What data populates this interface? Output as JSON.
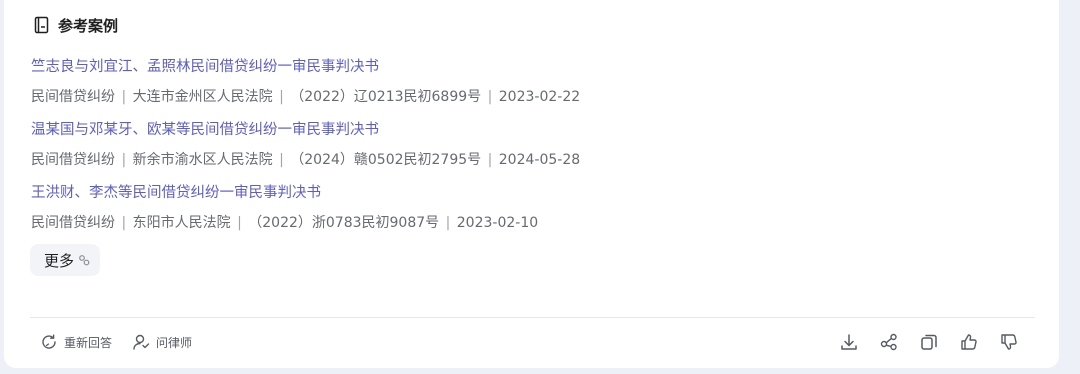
{
  "section": {
    "title": "参考案例",
    "icon": "document-icon"
  },
  "cases": [
    {
      "title": "竺志良与刘宜江、孟照林民间借贷纠纷一审民事判决书",
      "cause": "民间借贷纠纷",
      "court": "大连市金州区人民法院",
      "case_no": "（2022）辽0213民初6899号",
      "date": "2023-02-22"
    },
    {
      "title": "温某国与邓某牙、欧某等民间借贷纠纷一审民事判决书",
      "cause": "民间借贷纠纷",
      "court": "新余市渝水区人民法院",
      "case_no": "（2024）赣0502民初2795号",
      "date": "2024-05-28"
    },
    {
      "title": "王洪财、李杰等民间借贷纠纷一审民事判决书",
      "cause": "民间借贷纠纷",
      "court": "东阳市人民法院",
      "case_no": "（2022）浙0783民初9087号",
      "date": "2023-02-10"
    }
  ],
  "more_button": {
    "label": "更多",
    "icon": "link-icon"
  },
  "footer": {
    "regenerate_label": "重新回答",
    "ask_lawyer_label": "问律师",
    "right_icons": [
      "download-icon",
      "share-icon",
      "copy-icon",
      "thumbs-up-icon",
      "thumbs-down-icon"
    ]
  },
  "colors": {
    "link": "#5b5fc7",
    "meta": "#666a73",
    "title": "#1f1f1f",
    "background": "#eef0f8"
  }
}
